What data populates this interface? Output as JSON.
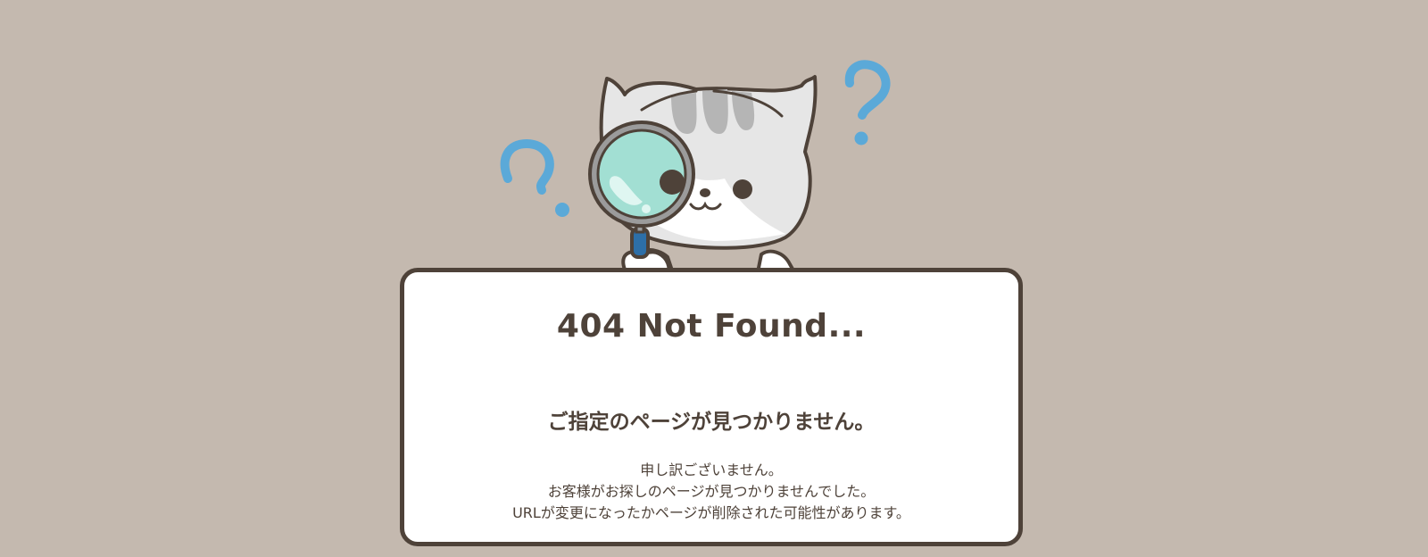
{
  "error": {
    "title": "404 Not Found...",
    "subtitle": "ご指定のページが見つかりません。",
    "message_lines": [
      "申し訳ございません。",
      "お客様がお探しのページが見つかりませんでした。",
      "URLが変更になったかページが削除された可能性があります。"
    ]
  },
  "illustration": {
    "subject": "cat-with-magnifying-glass",
    "decorations": [
      "question-mark-icon",
      "question-mark-icon"
    ]
  },
  "colors": {
    "background": "#c4b9af",
    "card": "#ffffff",
    "border_text": "#4e4239",
    "question_mark": "#5ba9d8",
    "lens": "#a2dfd3",
    "cat_gray": "#e5e5e5",
    "cat_stripe": "#b5b5b5",
    "handle": "#2d6fa8"
  }
}
